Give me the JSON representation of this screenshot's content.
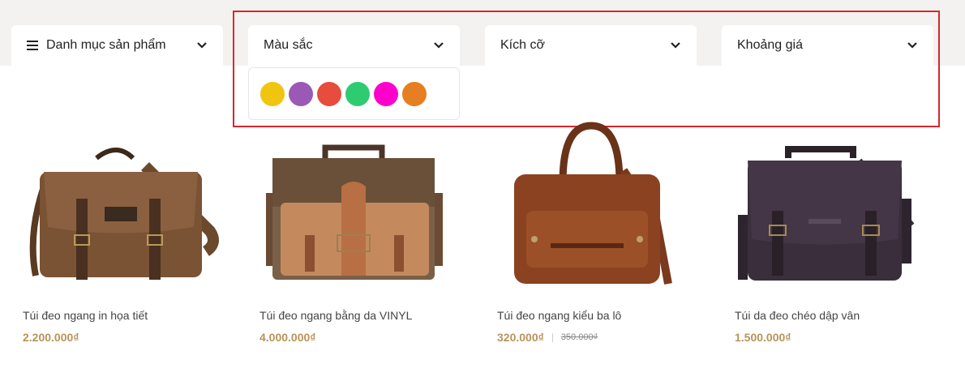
{
  "filters": [
    {
      "label": "Danh mục sản phẩm",
      "icon": "menu-icon"
    },
    {
      "label": "Màu sắc"
    },
    {
      "label": "Kích cỡ"
    },
    {
      "label": "Khoảng giá"
    }
  ],
  "color_swatches": [
    "#f1c40f",
    "#9b59b6",
    "#e74c3c",
    "#2ecc71",
    "#ff00cc",
    "#e67e22"
  ],
  "highlight_color": "#d9262c",
  "price_color": "#b8935a",
  "products": [
    {
      "name": "Túi đeo ngang in họa tiết",
      "price": "2.200.000₫",
      "old_price": ""
    },
    {
      "name": "Túi đeo ngang bằng da VINYL",
      "price": "4.000.000₫",
      "old_price": ""
    },
    {
      "name": "Túi đeo ngang kiểu ba lô",
      "price": "320.000₫",
      "old_price": "350.000₫"
    },
    {
      "name": "Túi da đeo chéo dập vân",
      "price": "1.500.000₫",
      "old_price": ""
    }
  ]
}
